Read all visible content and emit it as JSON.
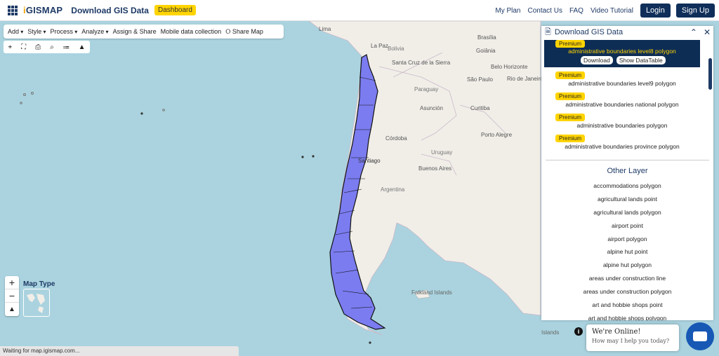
{
  "header": {
    "logo_text": "iGISMAP",
    "app_title": "Download GIS Data",
    "dashboard_label": "Dashboard",
    "nav": [
      "My Plan",
      "Contact Us",
      "FAQ",
      "Video Tutorial"
    ],
    "login_label": "Login",
    "signup_label": "Sign Up"
  },
  "toolbar": {
    "menu": [
      "Add",
      "Style",
      "Process",
      "Analyze",
      "Assign & Share",
      "Mobile data collection",
      "Share Map"
    ],
    "tools": [
      "locate-icon",
      "fullscreen-icon",
      "print-icon",
      "search-icon",
      "measure-icon",
      "layers-icon"
    ]
  },
  "map": {
    "labels": {
      "lima": "Lima",
      "la_paz": "La Paz",
      "bolivia": "Bolivia",
      "brasilia": "Brasília",
      "goiania": "Goiânia",
      "santa_cruz": "Santa Cruz de la Sierra",
      "belo_horizonte": "Belo Horizonte",
      "sao_paulo": "São Paulo",
      "rio": "Rio de Janeiro",
      "paraguay": "Paraguay",
      "asuncion": "Asunción",
      "curitiba": "Curitiba",
      "porto_alegre": "Porto Alegre",
      "cordoba": "Córdoba",
      "uruguay": "Uruguay",
      "santiago": "Santiago",
      "buenos_aires": "Buenos Aires",
      "argentina": "Argentina",
      "falkland": "Falkland Islands",
      "islands": "Islands"
    },
    "map_type_label": "Map Type",
    "status_text": "Waiting for map.igismap.com..."
  },
  "panel": {
    "title": "Download GIS Data",
    "premium_badge": "Premium",
    "premium_layers": [
      "administrative boundaries level8 polygon",
      "administrative boundaries level9 polygon",
      "administrative boundaries national polygon",
      "administrative boundaries polygon",
      "administrative boundaries province polygon"
    ],
    "download_label": "Download",
    "show_table_label": "Show DataTable",
    "other_title": "Other Layer",
    "other_layers": [
      "accommodations polygon",
      "agricultural lands point",
      "agricultural lands polygon",
      "airport point",
      "airport polygon",
      "alpine hut point",
      "alpine hut polygon",
      "areas under construction line",
      "areas under construction polygon",
      "art and hobbie shops point",
      "art and hobbie shops polygon"
    ]
  },
  "chat": {
    "line1": "We're Online!",
    "line2": "How may I help you today?"
  },
  "colors": {
    "brand": "#1e3a66",
    "accent": "#ffd400",
    "chile_fill": "#7b7cf0",
    "water": "#aad3df"
  }
}
